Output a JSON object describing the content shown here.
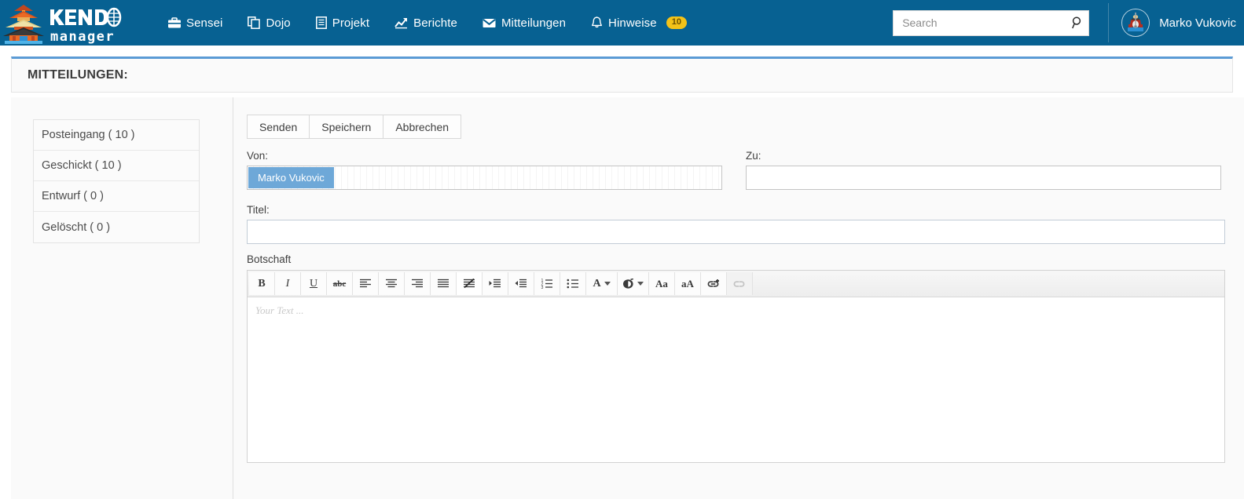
{
  "brand": {
    "name_line1": "KENDO",
    "name_line2": "manager",
    "logo_icon": "pagoda-icon"
  },
  "nav": {
    "items": [
      {
        "label": "Sensei",
        "icon": "briefcase-icon"
      },
      {
        "label": "Dojo",
        "icon": "copy-icon"
      },
      {
        "label": "Projekt",
        "icon": "document-icon"
      },
      {
        "label": "Berichte",
        "icon": "chart-line-icon"
      },
      {
        "label": "Mitteilungen",
        "icon": "envelope-icon"
      },
      {
        "label": "Hinweise",
        "icon": "bell-icon",
        "badge": "10"
      }
    ]
  },
  "search": {
    "placeholder": "Search",
    "value": "",
    "icon": "search-icon"
  },
  "user": {
    "name": "Marko Vukovic",
    "avatar_icon": "samurai-avatar-icon"
  },
  "panel": {
    "title": "MITTEILUNGEN:"
  },
  "folders": [
    {
      "label": "Posteingang ( 10 )"
    },
    {
      "label": "Geschickt ( 10 )"
    },
    {
      "label": "Entwurf ( 0 )"
    },
    {
      "label": "Gelöscht ( 0 )"
    }
  ],
  "actions": {
    "send": "Senden",
    "save": "Speichern",
    "cancel": "Abbrechen"
  },
  "form": {
    "from_label": "Von:",
    "from_token": "Marko Vukovic",
    "to_label": "Zu:",
    "to_value": "",
    "title_label": "Titel:",
    "title_value": "",
    "message_label": "Botschaft",
    "message_placeholder": "Your Text ..."
  },
  "editor_toolbar": [
    {
      "name": "bold-icon",
      "glyph": "B",
      "style": "txt-B",
      "state": "normal"
    },
    {
      "name": "italic-icon",
      "glyph": "I",
      "style": "txt-I",
      "state": "normal"
    },
    {
      "name": "underline-icon",
      "glyph": "U",
      "style": "txt-U",
      "state": "normal"
    },
    {
      "name": "strikethrough-icon",
      "glyph": "abc",
      "style": "txt-S",
      "state": "normal"
    },
    {
      "name": "align-left-icon",
      "glyph": "",
      "style": "svg-align-left",
      "state": "normal"
    },
    {
      "name": "align-center-icon",
      "glyph": "",
      "style": "svg-align-center",
      "state": "normal"
    },
    {
      "name": "align-right-icon",
      "glyph": "",
      "style": "svg-align-right",
      "state": "normal"
    },
    {
      "name": "align-justify-icon",
      "glyph": "",
      "style": "svg-align-justify",
      "state": "normal"
    },
    {
      "name": "remove-format-icon",
      "glyph": "",
      "style": "svg-remove-format",
      "state": "active"
    },
    {
      "name": "indent-increase-icon",
      "glyph": "",
      "style": "svg-indent-in",
      "state": "normal"
    },
    {
      "name": "indent-decrease-icon",
      "glyph": "",
      "style": "svg-indent-out",
      "state": "normal"
    },
    {
      "name": "ordered-list-icon",
      "glyph": "",
      "style": "svg-ol",
      "state": "normal"
    },
    {
      "name": "unordered-list-icon",
      "glyph": "",
      "style": "svg-ul",
      "state": "normal"
    },
    {
      "name": "font-color-icon",
      "glyph": "A",
      "style": "txt-A",
      "state": "dropdown"
    },
    {
      "name": "highlight-color-icon",
      "glyph": "",
      "style": "svg-highlight",
      "state": "dropdown"
    },
    {
      "name": "font-size-increase-icon",
      "glyph": "Aa",
      "style": "txt-Aa",
      "state": "normal"
    },
    {
      "name": "font-size-decrease-icon",
      "glyph": "aA",
      "style": "txt-Aa",
      "state": "normal"
    },
    {
      "name": "insert-link-icon",
      "glyph": "",
      "style": "svg-link-add",
      "state": "normal"
    },
    {
      "name": "remove-link-icon",
      "glyph": "",
      "style": "svg-link-remove",
      "state": "disabled"
    }
  ],
  "colors": {
    "header_blue": "#076192",
    "accent_blue": "#5b9bd5",
    "badge_yellow": "#f3c218",
    "token_blue": "#6ea8d8"
  }
}
